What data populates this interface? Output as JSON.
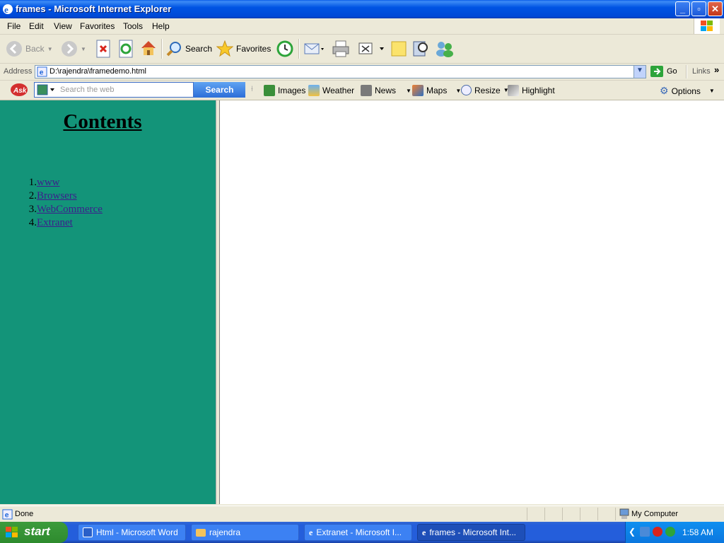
{
  "window": {
    "title": "frames - Microsoft Internet Explorer"
  },
  "menu": [
    "File",
    "Edit",
    "View",
    "Favorites",
    "Tools",
    "Help"
  ],
  "toolbar": {
    "back": "Back",
    "search": "Search",
    "favorites": "Favorites"
  },
  "address": {
    "label": "Address",
    "url": "D:\\rajendra\\framedemo.html",
    "go": "Go",
    "links": "Links"
  },
  "askbar": {
    "placeholder": "Search the web",
    "search_button": "Search",
    "items": [
      "Images",
      "Weather",
      "News",
      "Maps",
      "Resize",
      "Highlight"
    ],
    "options": "Options"
  },
  "page": {
    "heading": "Contents",
    "items": [
      {
        "num": "1.",
        "label": "www"
      },
      {
        "num": "2.",
        "label": "Browsers"
      },
      {
        "num": "3.",
        "label": "WebCommerce"
      },
      {
        "num": "4.",
        "label": "Extranet"
      }
    ]
  },
  "status": {
    "text": "Done",
    "zone": "My Computer"
  },
  "taskbar": {
    "start": "start",
    "tasks": [
      "Html - Microsoft Word",
      "rajendra",
      "Extranet - Microsoft I...",
      "frames - Microsoft Int..."
    ],
    "clock": "1:58 AM"
  }
}
